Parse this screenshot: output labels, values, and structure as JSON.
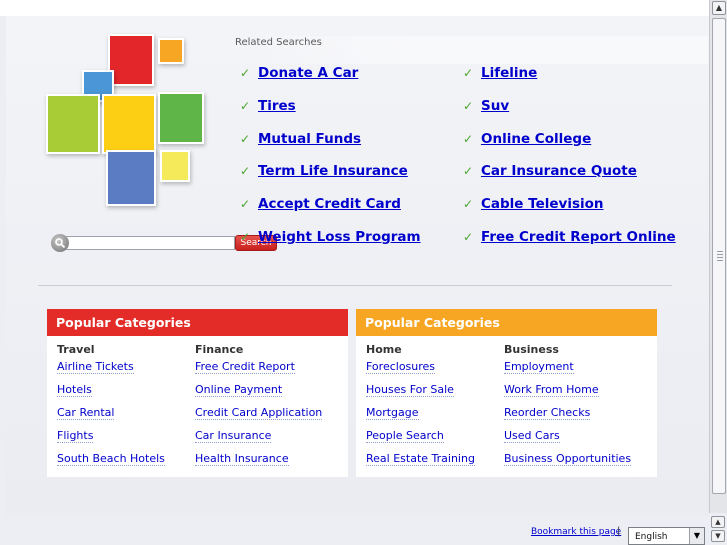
{
  "related": {
    "title": "Related Searches",
    "left": [
      "Donate A Car",
      "Tires",
      "Mutual Funds",
      "Term Life Insurance",
      "Accept Credit Card",
      "Weight Loss Program"
    ],
    "right": [
      "Lifeline",
      "Suv",
      "Online College",
      "Car Insurance Quote",
      "Cable Television",
      "Free Credit Report Online"
    ]
  },
  "search": {
    "button_label": "Search",
    "value": ""
  },
  "categories": [
    {
      "header": "Popular Categories",
      "color": "#e32c27",
      "columns": [
        {
          "title": "Travel",
          "links": [
            "Airline Tickets",
            "Hotels",
            "Car Rental",
            "Flights",
            "South Beach Hotels"
          ]
        },
        {
          "title": "Finance",
          "links": [
            "Free Credit Report",
            "Online Payment",
            "Credit Card Application",
            "Car Insurance",
            "Health Insurance"
          ]
        }
      ]
    },
    {
      "header": "Popular Categories",
      "color": "#f7a623",
      "columns": [
        {
          "title": "Home",
          "links": [
            "Foreclosures",
            "Houses For Sale",
            "Mortgage",
            "People Search",
            "Real Estate Training"
          ]
        },
        {
          "title": "Business",
          "links": [
            "Employment",
            "Work From Home",
            "Reorder Checks",
            "Used Cars",
            "Business Opportunities"
          ]
        }
      ]
    }
  ],
  "footer": {
    "bookmark": "Bookmark this page",
    "separator": "|",
    "language": "English"
  },
  "icons": {
    "check": "check-icon",
    "search": "magnifier-icon",
    "dropdown": "chevron-down-icon"
  }
}
